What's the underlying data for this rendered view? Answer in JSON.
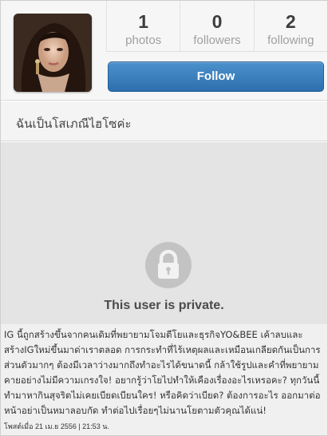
{
  "profile": {
    "stats": [
      {
        "value": "1",
        "label": "photos"
      },
      {
        "value": "0",
        "label": "followers"
      },
      {
        "value": "2",
        "label": "following"
      }
    ],
    "follow_label": "Follow",
    "bio": "ฉันเป็นโสเภณีไฮโซค่ะ"
  },
  "private": {
    "message": "This user is private.",
    "icon": "lock-icon"
  },
  "caption": {
    "text": "IG นี้ถูกสร้างขึ้นจากคนเดิมที่พยายามโจมตีโยและธุรกิจYO&BEE เค้าลบและสร้างIGใหม่ขึ้นมาด่าเราตลอด การกระทำที่ไร้เหตุผลและเหมือนเกลียดกันเป็นการส่วนตัวมากๆ ต้องมีเวลาว่างมากถึงทำอะไรได้ขนาดนี้ กล้าใช้รูปและคำที่พยายามคายอย่างไม่มีความเกรงใจ! อยากรู้ว่าโยไปทำให้เคืองเรื่องอะไรเหรอคะ? ทุกวันนี้ทำมาหากินสุจริตไม่เคยเบียดเบียนใคร! หรือคิดว่าเบียด? ต้องการอะไร ออกมาต่อหน้าอย่าเป็นหมาลอบกัด ทำต่อไปเรื่อยๆไม่นานโยตามตัวคุณได้แน่!",
    "meta": "โพสต์เมื่อ 21 เม.ย 2556 | 21:53 น."
  },
  "colors": {
    "follow_button": "#2d6fae",
    "private_bg": "#e4e4e4"
  }
}
